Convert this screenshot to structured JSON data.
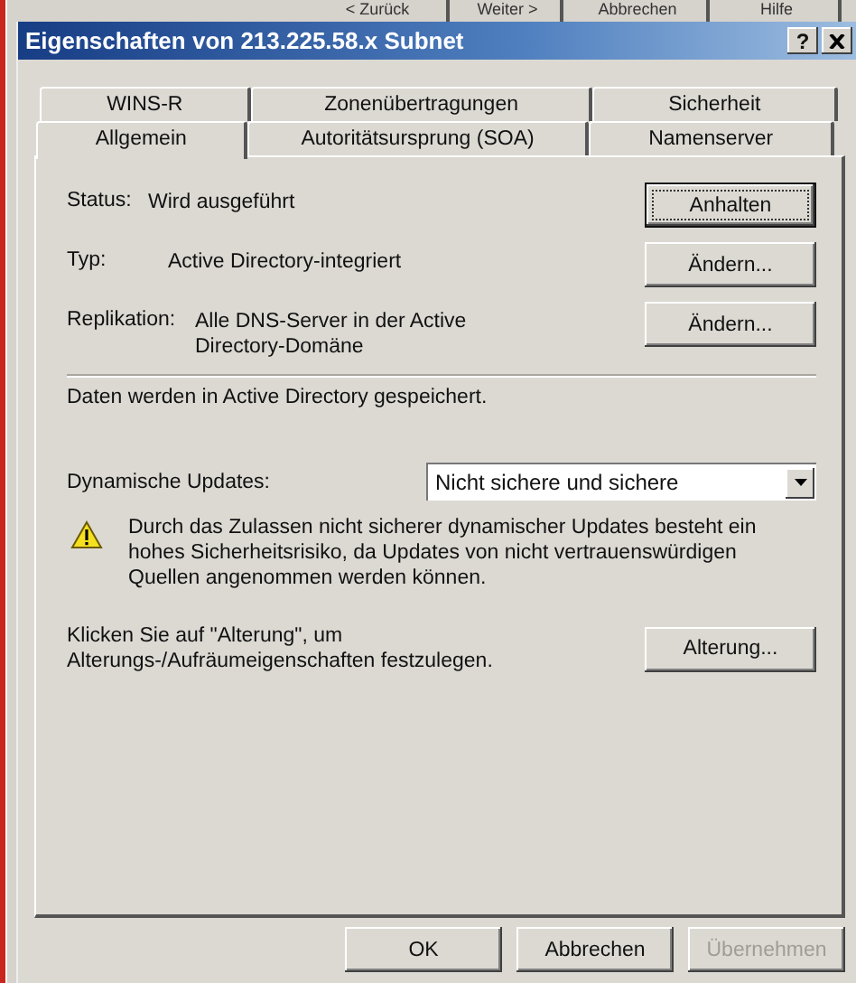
{
  "background_buttons": [
    "< Zurück",
    "Weiter >",
    "Abbrechen",
    "Hilfe"
  ],
  "window": {
    "title": "Eigenschaften von 213.225.58.x Subnet",
    "help": "?"
  },
  "tabs": [
    [
      {
        "label": "WINS-R",
        "selected": false
      },
      {
        "label": "Zonenübertragungen",
        "selected": false
      },
      {
        "label": "Sicherheit",
        "selected": false
      }
    ],
    [
      {
        "label": "Allgemein",
        "selected": true
      },
      {
        "label": "Autoritätsursprung (SOA)",
        "selected": false
      },
      {
        "label": "Namenserver",
        "selected": false
      }
    ]
  ],
  "info_rows": [
    {
      "label": "Status:",
      "value_lines": [
        "Wird ausgeführt"
      ],
      "button": {
        "label": "Anhalten",
        "focused": true
      }
    },
    {
      "label": "Typ:",
      "value_lines": [
        "Active Directory-integriert"
      ],
      "button": {
        "label": "Ändern...",
        "focused": false
      }
    },
    {
      "label": "Replikation:",
      "value_lines": [
        "Alle DNS-Server in der Active",
        "Directory-Domäne"
      ],
      "button": {
        "label": "Ändern...",
        "focused": false
      }
    }
  ],
  "storage_note": "Daten werden in Active Directory gespeichert.",
  "dynamic_updates": {
    "label": "Dynamische Updates:",
    "value": "Nicht sichere und sichere"
  },
  "warning_lines": [
    "Durch das Zulassen nicht sicherer dynamischer Updates besteht ein",
    "hohes Sicherheitsrisiko, da Updates von nicht vertrauenswürdigen",
    "Quellen angenommen werden können."
  ],
  "aging": {
    "lines": [
      "Klicken Sie auf \"Alterung\", um",
      "Alterungs-/Aufräumeigenschaften festzulegen."
    ],
    "button": "Alterung..."
  },
  "footer_buttons": [
    {
      "label": "OK",
      "disabled": false
    },
    {
      "label": "Abbrechen",
      "disabled": false
    },
    {
      "label": "Übernehmen",
      "disabled": true
    }
  ]
}
